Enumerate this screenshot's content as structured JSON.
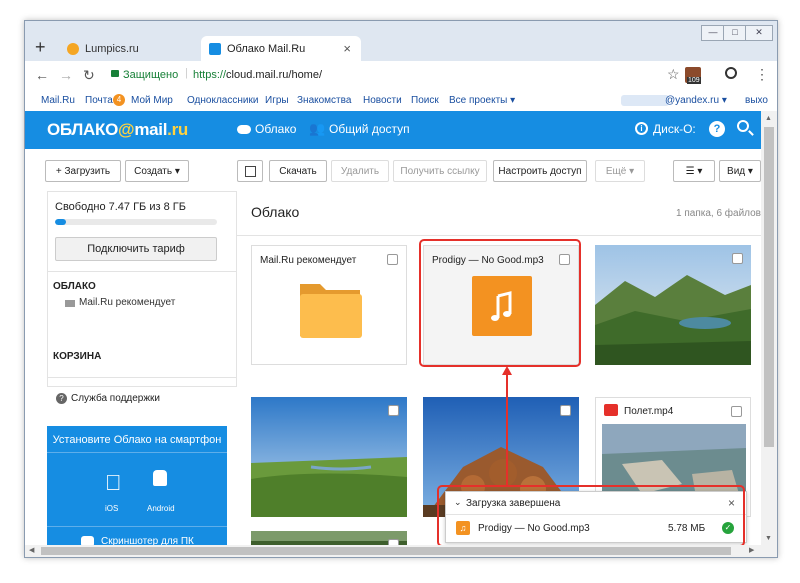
{
  "browser": {
    "tabs": [
      {
        "label": "Lumpics.ru"
      },
      {
        "label": "Облако Mail.Ru"
      }
    ],
    "tab_close": "×",
    "new_tab": "+",
    "secure_label": "Защищено",
    "url_scheme": "https://",
    "url_rest": "cloud.mail.ru/home/",
    "ext_badge": "109"
  },
  "bookmarks": {
    "items": [
      "Mail.Ru",
      "Почта",
      "Мой Мир",
      "Одноклассники",
      "Игры",
      "Знакомства",
      "Новости",
      "Поиск",
      "Все проекты ▾"
    ],
    "mail_badge": "4",
    "account": "@yandex.ru ▾",
    "logout": "выхо"
  },
  "header": {
    "logo_prefix": "ОБЛАКО",
    "logo_at": "@",
    "logo_mail": "mail",
    "logo_ru": ".ru",
    "nav_cloud": "Облако",
    "nav_shared": "Общий доступ",
    "disk": "Диск-О:"
  },
  "toolbar": {
    "upload": "+ Загрузить",
    "create": "Создать ▾",
    "download": "Скачать",
    "delete": "Удалить",
    "get_link": "Получить ссылку",
    "access": "Настроить доступ",
    "more": "Ещё ▾",
    "sort": "▾",
    "view": "Вид ▾"
  },
  "sidebar": {
    "storage": "Свободно 7.47 ГБ из 8 ГБ",
    "storage_used": 0.07,
    "tariff": "Подключить тариф",
    "section_cloud": "ОБЛАКО",
    "folder_item": "Mail.Ru рекомендует",
    "section_trash": "КОРЗИНА",
    "support": "Служба поддержки",
    "promo_title": "Установите Облако на смартфон",
    "ios": "iOS",
    "android": "Android",
    "screenshoter": "Скриншотер для ПК"
  },
  "main": {
    "title": "Облако",
    "count": "1 папка, 6 файлов",
    "folder_name": "Mail.Ru рекомендует",
    "mp3_name": "Prodigy — No Good.mp3",
    "video_name": "Полет.mp4"
  },
  "upload": {
    "title": "Загрузка завершена",
    "close": "×",
    "file": "Prodigy — No Good.mp3",
    "size": "5.78 МБ"
  },
  "colors": {
    "brand": "#168de2",
    "highlight": "#e5302a",
    "file_orange": "#f39221",
    "folder_yellow": "#fdbd4d"
  }
}
